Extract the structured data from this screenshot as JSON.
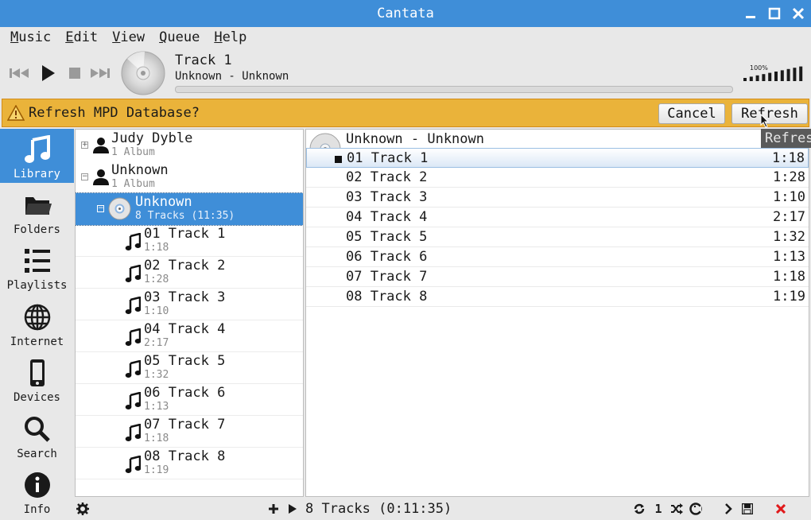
{
  "window": {
    "title": "Cantata"
  },
  "menu": [
    "Music",
    "Edit",
    "View",
    "Queue",
    "Help"
  ],
  "now_playing": {
    "title": "Track 1",
    "subtitle": "Unknown - Unknown",
    "progress": 0,
    "volume_label": "100%",
    "volume": 1.0
  },
  "infobar": {
    "message": "Refresh MPD Database?",
    "cancel_label": "Cancel",
    "refresh_label": "Refresh",
    "tooltip": "Refresh"
  },
  "sidebar": [
    {
      "label": "Library",
      "icon": "music-note-icon",
      "active": true
    },
    {
      "label": "Folders",
      "icon": "folder-icon"
    },
    {
      "label": "Playlists",
      "icon": "playlist-icon"
    },
    {
      "label": "Internet",
      "icon": "globe-icon"
    },
    {
      "label": "Devices",
      "icon": "phone-icon"
    },
    {
      "label": "Search",
      "icon": "search-icon"
    },
    {
      "label": "Info",
      "icon": "info-icon"
    }
  ],
  "library": {
    "artists": [
      {
        "name": "Judy Dyble",
        "sub": "1 Album",
        "expander": "+"
      },
      {
        "name": "Unknown",
        "sub": "1 Album",
        "expander": "−"
      }
    ],
    "album": {
      "name": "Unknown",
      "sub": "8 Tracks (11:35)",
      "expander": "−"
    },
    "tracks": [
      {
        "name": "01 Track 1",
        "time": "1:18"
      },
      {
        "name": "02 Track 2",
        "time": "1:28"
      },
      {
        "name": "03 Track 3",
        "time": "1:10"
      },
      {
        "name": "04 Track 4",
        "time": "2:17"
      },
      {
        "name": "05 Track 5",
        "time": "1:32"
      },
      {
        "name": "06 Track 6",
        "time": "1:13"
      },
      {
        "name": "07 Track 7",
        "time": "1:18"
      },
      {
        "name": "08 Track 8",
        "time": "1:19"
      }
    ]
  },
  "playqueue": {
    "header": "Unknown - Unknown",
    "rows": [
      {
        "name": "01 Track 1",
        "time": "1:18"
      },
      {
        "name": "02 Track 2",
        "time": "1:28"
      },
      {
        "name": "03 Track 3",
        "time": "1:10"
      },
      {
        "name": "04 Track 4",
        "time": "2:17"
      },
      {
        "name": "05 Track 5",
        "time": "1:32"
      },
      {
        "name": "06 Track 6",
        "time": "1:13"
      },
      {
        "name": "07 Track 7",
        "time": "1:18"
      },
      {
        "name": "08 Track 8",
        "time": "1:19"
      }
    ]
  },
  "statusbar": {
    "summary": "8 Tracks (0:11:35)",
    "single_label": "1"
  },
  "colors": {
    "accent": "#3f8ed8",
    "infobar": "#eab33a",
    "remove": "#e0191b"
  }
}
